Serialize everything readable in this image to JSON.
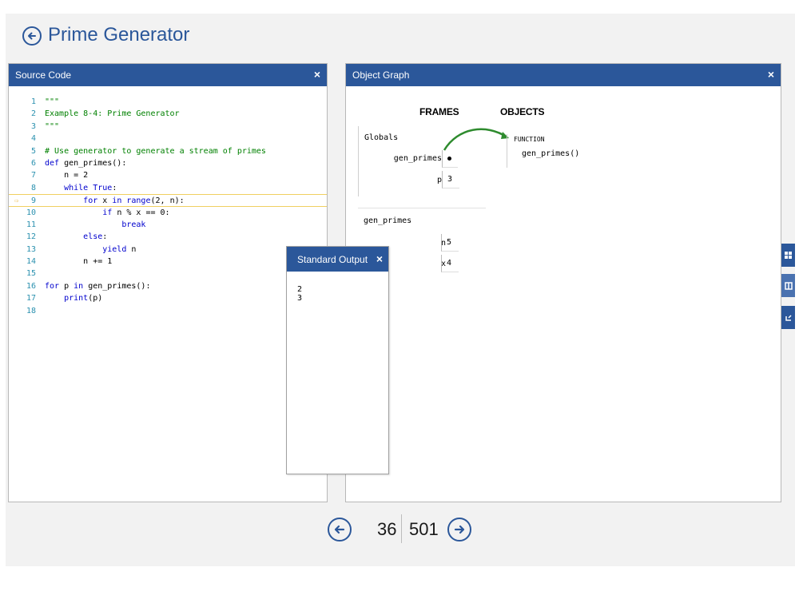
{
  "header": {
    "title": "Prime Generator",
    "back_icon": "arrow-left-circle-icon"
  },
  "source_panel": {
    "title": "Source Code",
    "close_label": "×",
    "current_line": 9,
    "lines": [
      {
        "n": "1",
        "code": "\"\"\""
      },
      {
        "n": "2",
        "code": "Example 8-4: Prime Generator"
      },
      {
        "n": "3",
        "code": "\"\"\""
      },
      {
        "n": "4",
        "code": ""
      },
      {
        "n": "5",
        "code": "# Use generator to generate a stream of primes"
      },
      {
        "n": "6",
        "code": "def gen_primes():"
      },
      {
        "n": "7",
        "code": "    n = 2"
      },
      {
        "n": "8",
        "code": "    while True:"
      },
      {
        "n": "9",
        "code": "        for x in range(2, n):"
      },
      {
        "n": "10",
        "code": "            if n % x == 0:"
      },
      {
        "n": "11",
        "code": "                break"
      },
      {
        "n": "12",
        "code": "        else:"
      },
      {
        "n": "13",
        "code": "            yield n"
      },
      {
        "n": "14",
        "code": "        n += 1"
      },
      {
        "n": "15",
        "code": ""
      },
      {
        "n": "16",
        "code": "for p in gen_primes():"
      },
      {
        "n": "17",
        "code": "    print(p)"
      },
      {
        "n": "18",
        "code": ""
      }
    ]
  },
  "graph_panel": {
    "title": "Object Graph",
    "close_label": "×",
    "frames_heading": "FRAMES",
    "objects_heading": "OBJECTS",
    "globals": {
      "name": "Globals",
      "vars": [
        {
          "name": "gen_primes",
          "value": ""
        },
        {
          "name": "p",
          "value": "3"
        }
      ]
    },
    "gen_frame": {
      "name": "gen_primes",
      "vars": [
        {
          "name": "n",
          "value": "5"
        },
        {
          "name": "x",
          "value": "4"
        }
      ]
    },
    "object": {
      "type": "FUNCTION",
      "name": "gen_primes()"
    }
  },
  "stdout": {
    "title": "Standard Output",
    "close_label": "×",
    "lines": [
      "2",
      "3"
    ]
  },
  "side_tabs": [
    "grid-icon",
    "book-icon",
    "refresh-icon"
  ],
  "nav": {
    "current": "36",
    "total": "501",
    "prev_icon": "arrow-left-circle-icon",
    "next_icon": "arrow-right-circle-icon"
  },
  "colors": {
    "accent": "#2b579a",
    "current_line": "#f0d060",
    "pointer_arrow": "#2e8b2e"
  }
}
